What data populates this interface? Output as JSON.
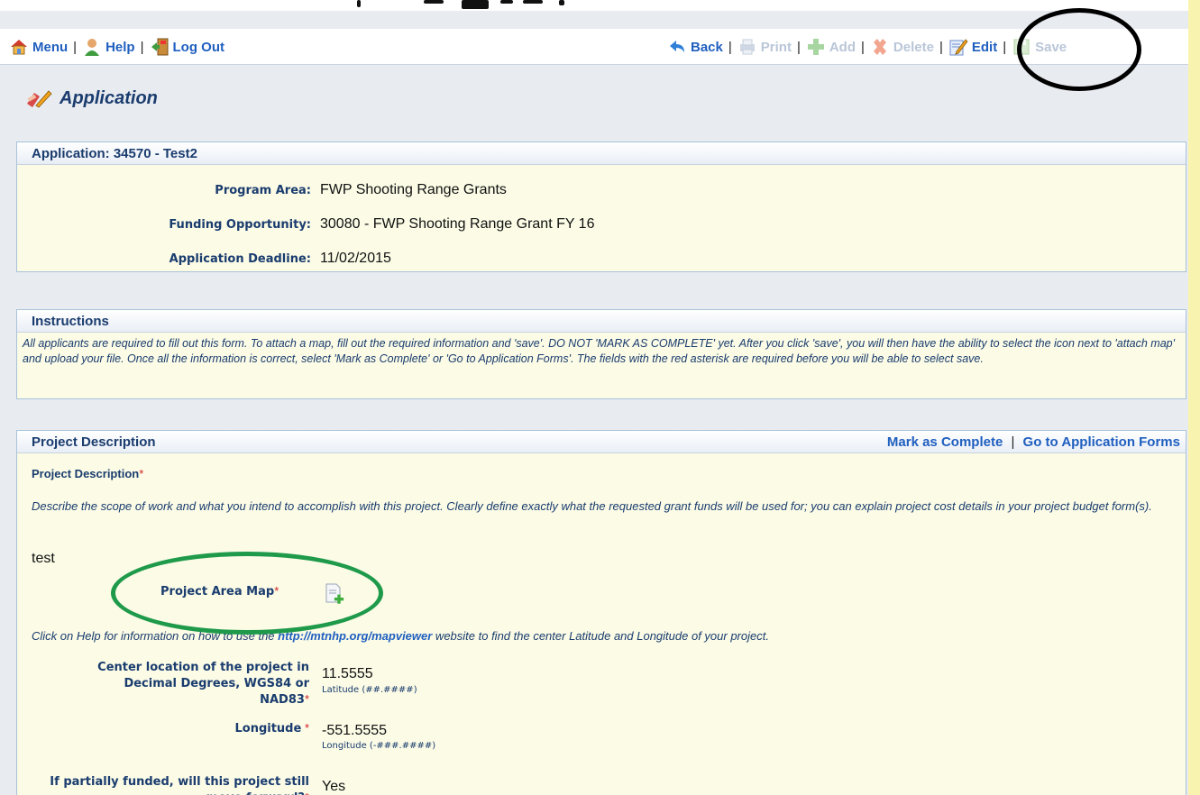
{
  "toolbar": {
    "menu": "Menu",
    "help": "Help",
    "logout": "Log Out",
    "back": "Back",
    "print": "Print",
    "add": "Add",
    "delete": "Delete",
    "edit": "Edit",
    "save": "Save",
    "sep": "|"
  },
  "page_title": "Application",
  "application": {
    "header": "Application: 34570 - Test2",
    "fields": [
      {
        "label": "Program Area:",
        "value": "FWP Shooting Range Grants"
      },
      {
        "label": "Funding Opportunity:",
        "value": "30080 - FWP Shooting Range Grant FY 16"
      },
      {
        "label": "Application Deadline:",
        "value": "11/02/2015"
      }
    ]
  },
  "instructions": {
    "header": "Instructions",
    "text": "All applicants are required to fill out this form. To attach a map, fill out the required information and 'save'. DO NOT 'MARK AS COMPLETE' yet. After you click 'save', you will then have the ability to select the icon next to 'attach map' and upload your file. Once all the information is correct, select 'Mark as Complete' or 'Go to Application Forms'. The fields with the red asterisk are required before you will be able to select save."
  },
  "project": {
    "header": "Project Description",
    "mark_complete": "Mark as Complete",
    "go_to_forms": "Go to Application Forms",
    "desc_label": "Project Description",
    "asterisk": "*",
    "desc_help": "Describe the scope of work and what you intend to accomplish with this project. Clearly define exactly what the requested grant funds will be used for; you can explain project cost details in your project budget form(s).",
    "desc_value": "test",
    "map_label": "Project Area Map",
    "help_pre": "Click on Help for information on how to use the ",
    "help_link": "http://mtnhp.org/mapviewer",
    "help_post": " website to find the center Latitude and Longitude of your project.",
    "center_label": "Center location of the project in Decimal Degrees, WGS84 or NAD83",
    "latitude_value": "11.5555",
    "latitude_hint": "Latitude (##.####)",
    "longitude_label": "Longitude",
    "longitude_value": "-551.5555",
    "longitude_hint": "Longitude (-###.####)",
    "partial_label": "If partially funded, will this project still move forward?",
    "partial_value": "Yes"
  }
}
